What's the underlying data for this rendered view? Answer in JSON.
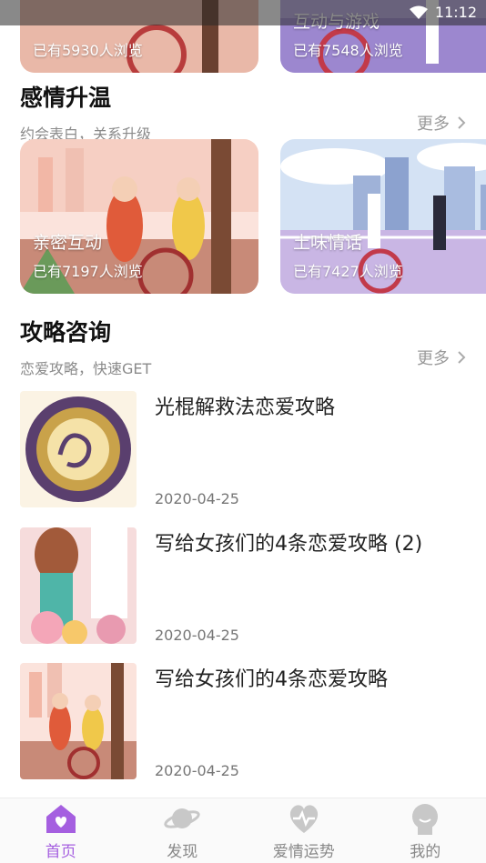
{
  "status_bar": {
    "time": "11:12"
  },
  "top_cards": [
    {
      "title": "",
      "sub": "已有5930人浏览"
    },
    {
      "title": "互动与游戏",
      "sub": "已有7548人浏览"
    }
  ],
  "section_love": {
    "title": "感情升温",
    "desc": "约会表白，关系升级",
    "more": "更多",
    "cards": [
      {
        "title": "亲密互动",
        "sub": "已有7197人浏览"
      },
      {
        "title": "土味情话",
        "sub": "已有7427人浏览"
      }
    ]
  },
  "section_tips": {
    "title": "攻略咨询",
    "desc": "恋爱攻略，快速GET",
    "more": "更多",
    "articles": [
      {
        "title": "光棍解救法恋爱攻略",
        "date": "2020-04-25"
      },
      {
        "title": "写给女孩们的4条恋爱攻略 (2)",
        "date": "2020-04-25"
      },
      {
        "title": "写给女孩们的4条恋爱攻略",
        "date": "2020-04-25"
      }
    ]
  },
  "tabbar": {
    "tabs": [
      {
        "label": "首页"
      },
      {
        "label": "发现"
      },
      {
        "label": "爱情运势"
      },
      {
        "label": "我的"
      }
    ]
  },
  "colors": {
    "accent": "#a55fe0",
    "inactive": "#c8c8c8"
  }
}
